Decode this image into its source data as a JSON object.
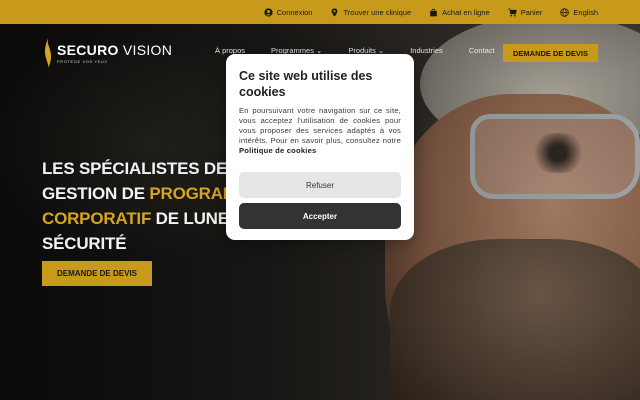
{
  "topbar": {
    "links": [
      {
        "label": "Connexion",
        "icon": "user-icon"
      },
      {
        "label": "Trouver une clinique",
        "icon": "location-pin-icon"
      },
      {
        "label": "Achat en ligne",
        "icon": "shopping-bag-icon"
      },
      {
        "label": "Panier",
        "icon": "cart-icon"
      },
      {
        "label": "English",
        "icon": "globe-icon"
      }
    ],
    "color": "#c79a1c"
  },
  "brand": {
    "name_bold": "SECURO",
    "name_light": " VISION",
    "tagline": "PROTÉGE VOS YEUX"
  },
  "nav": {
    "items": [
      "À propos",
      "Programmes ⌄",
      "Produits ⌄",
      "Industries",
      "Contact"
    ],
    "cta": "DEMANDE DE DEVIS"
  },
  "hero": {
    "line1": "LES SPÉCIALISTES DE",
    "line2_plain": "GESTION DE ",
    "line2_gold": "PROGRAM",
    "line3_gold": "CORPORATIF",
    "line3_plain": " DE LUNE",
    "line4": "SÉCURITÉ",
    "cta": "DEMANDE DE DEVIS",
    "accent": "#d6a51f"
  },
  "cookie": {
    "title": "Ce site web utilise des cookies",
    "body": "En poursuivant votre navigation sur ce site, vous acceptez l'utilisation de cookies pour vous proposer des services adaptés à vos intérêts. Pour en savoir plus, consultez notre",
    "policy_link": "Politique de cookies",
    "refuse": "Refuser",
    "accept": "Accepter"
  }
}
